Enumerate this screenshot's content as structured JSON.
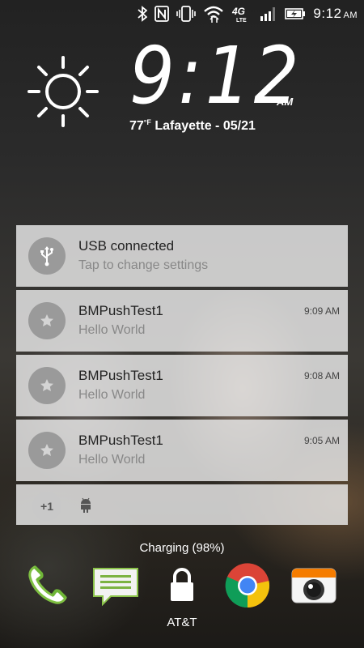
{
  "status_bar": {
    "time": "9:12",
    "ampm": "AM",
    "network": "4G LTE",
    "icons": [
      "bluetooth-icon",
      "nfc-icon",
      "vibrate-icon",
      "wifi-icon",
      "lte-icon",
      "signal-icon",
      "battery-charging-icon"
    ]
  },
  "lockscreen": {
    "time": "9:12",
    "ampm": "AM",
    "temperature": "77",
    "temp_unit": "°F",
    "location_date": "Lafayette - 05/21",
    "weather_icon": "sun-icon"
  },
  "notifications": [
    {
      "title": "USB connected",
      "subtitle": "Tap to change settings",
      "time": "",
      "icon": "usb-icon"
    },
    {
      "title": "BMPushTest1",
      "subtitle": "Hello World",
      "time": "9:09 AM",
      "icon": "star-icon"
    },
    {
      "title": "BMPushTest1",
      "subtitle": "Hello World",
      "time": "9:08 AM",
      "icon": "star-icon"
    },
    {
      "title": "BMPushTest1",
      "subtitle": "Hello World",
      "time": "9:05 AM",
      "icon": "star-icon"
    }
  ],
  "overflow": {
    "count_label": "+1",
    "icon": "android-icon"
  },
  "charging_text": "Charging (98%)",
  "dock": {
    "apps": [
      "phone-icon",
      "messages-icon",
      "lock-icon",
      "chrome-icon",
      "camera-icon"
    ],
    "carrier": "AT&T"
  }
}
